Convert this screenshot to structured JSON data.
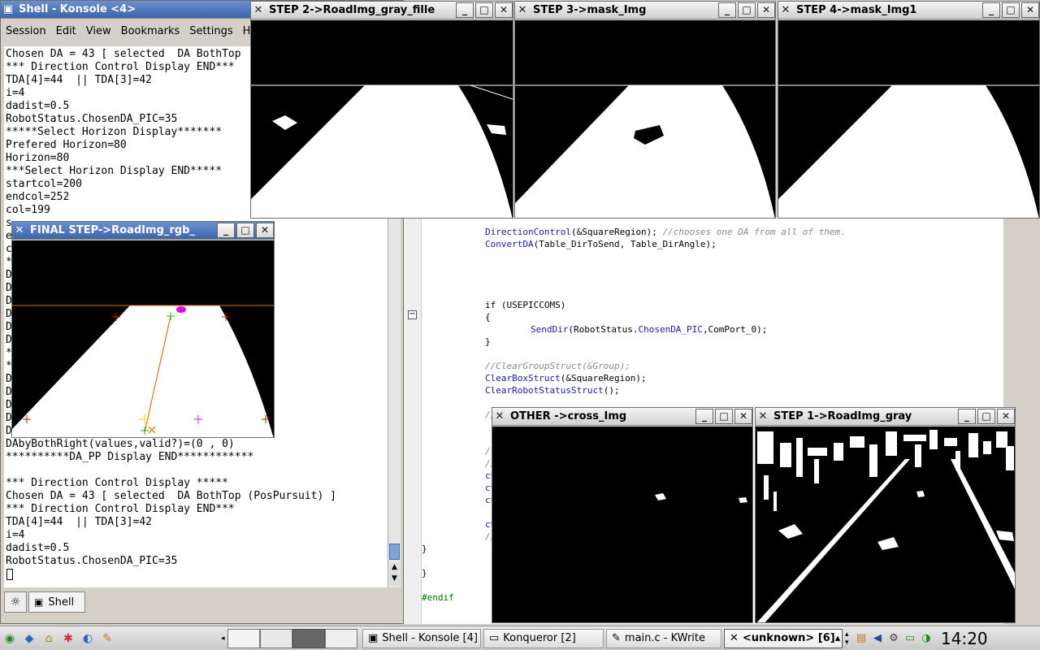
{
  "konsole": {
    "title": "Shell - Konsole <4>",
    "menu": [
      "Session",
      "Edit",
      "View",
      "Bookmarks",
      "Settings",
      "Help"
    ],
    "lines_top": [
      "Chosen DA = 43 [ selected  DA BothTop",
      "*** Direction Control Display END***",
      "TDA[4]=44  || TDA[3]=42",
      "i=4",
      "dadist=0.5",
      "RobotStatus.ChosenDA_PIC=35",
      "*****Select Horizon Display*******",
      "Prefered Horizon=80",
      "Horizon=80",
      "***Select Horizon Display END*****",
      "startcol=200",
      "endcol=252",
      "col=199"
    ],
    "lines_left": [
      "s",
      "e",
      "c",
      "*",
      "D",
      "D",
      "D",
      "D",
      "D",
      "D",
      "*",
      "*",
      "D",
      "D",
      "D",
      "D",
      "D"
    ],
    "lines_bottom": [
      "DAbyBothRight(values,valid?)=(0 , 0)",
      "**********DA_PP Display END************",
      "",
      "*** Direction Control Display *****",
      "Chosen DA = 43 [ selected  DA BothTop (PosPursuit) ]",
      "*** Direction Control Display END***",
      "TDA[4]=44  || TDA[3]=42",
      "i=4",
      "dadist=0.5",
      "RobotStatus.ChosenDA_PIC=35"
    ],
    "tab_label": "Shell"
  },
  "windows": {
    "step2": {
      "title": "STEP 2->RoadImg_gray_fille"
    },
    "step3": {
      "title": "STEP 3->mask_Img"
    },
    "step4": {
      "title": "STEP 4->mask_Img1"
    },
    "final": {
      "title": "FINAL STEP->RoadImg_rgb_"
    },
    "other": {
      "title": "OTHER ->cross_Img"
    },
    "step1": {
      "title": "STEP 1->RoadImg_gray"
    }
  },
  "editor": {
    "lines": [
      {
        "type": "code",
        "parts": [
          [
            "fn",
            "DirectionControl"
          ],
          [
            "kw",
            "(&SquareRegion); "
          ],
          [
            "cm",
            "//chooses one DA from all of them."
          ]
        ]
      },
      {
        "type": "code",
        "parts": [
          [
            "fn",
            "ConvertDA"
          ],
          [
            "kw",
            "(Table_DirToSend, Table_DirAngle);"
          ]
        ]
      },
      {
        "type": "code",
        "parts": [
          [
            "kw",
            "if (USEPICCOMS)"
          ]
        ]
      },
      {
        "type": "code",
        "parts": [
          [
            "kw",
            "{"
          ]
        ]
      },
      {
        "type": "code",
        "parts": [
          [
            "fn",
            "SendDir"
          ],
          [
            "kw",
            "(RobotStatus."
          ],
          [
            "fn",
            "ChosenDA_PIC"
          ],
          [
            "kw",
            ",ComPort_0);"
          ]
        ]
      },
      {
        "type": "code",
        "parts": [
          [
            "kw",
            "}"
          ]
        ]
      },
      {
        "type": "code",
        "parts": [
          [
            "cm",
            "//ClearGroupStruct(&Group);"
          ]
        ]
      },
      {
        "type": "code",
        "parts": [
          [
            "fn",
            "ClearBoxStruct"
          ],
          [
            "kw",
            "(&SquareRegion);"
          ]
        ]
      },
      {
        "type": "code",
        "parts": [
          [
            "fn",
            "ClearRobotStatusStruct"
          ],
          [
            "kw",
            "();"
          ]
        ]
      },
      {
        "type": "code",
        "parts": [
          [
            "cm",
            "//fo"
          ]
        ]
      },
      {
        "type": "code",
        "parts": [
          [
            "cm",
            "/*Sh"
          ]
        ]
      },
      {
        "type": "code",
        "parts": [
          [
            "cm",
            "//cv"
          ]
        ]
      },
      {
        "type": "code",
        "parts": [
          [
            "fn",
            "cvSho"
          ]
        ]
      },
      {
        "type": "code",
        "parts": [
          [
            "fn",
            "cvSho"
          ]
        ]
      },
      {
        "type": "code",
        "parts": [
          [
            "fn",
            "cvSho"
          ]
        ]
      },
      {
        "type": "code",
        "parts": [
          [
            "fn",
            "cvWa"
          ]
        ]
      },
      {
        "type": "code",
        "parts": [
          [
            "cm",
            "//ex"
          ]
        ]
      },
      {
        "type": "code",
        "parts": [
          [
            "kw",
            "}"
          ]
        ]
      },
      {
        "type": "code",
        "parts": [
          [
            "kw",
            "}"
          ]
        ]
      },
      {
        "type": "code",
        "parts": [
          [
            "pp",
            "#endif"
          ]
        ]
      }
    ]
  },
  "taskbar": {
    "tasks": [
      {
        "label": "Shell - Konsole [4]",
        "icon": "terminal-icon",
        "active": false
      },
      {
        "label": "Konqueror [2]",
        "icon": "folder-icon",
        "active": false
      },
      {
        "label": "main.c - KWrite",
        "icon": "kwrite-icon",
        "active": false
      },
      {
        "label": "<unknown> [6]",
        "icon": "x-icon",
        "active": true
      }
    ],
    "clock": "14:20"
  }
}
